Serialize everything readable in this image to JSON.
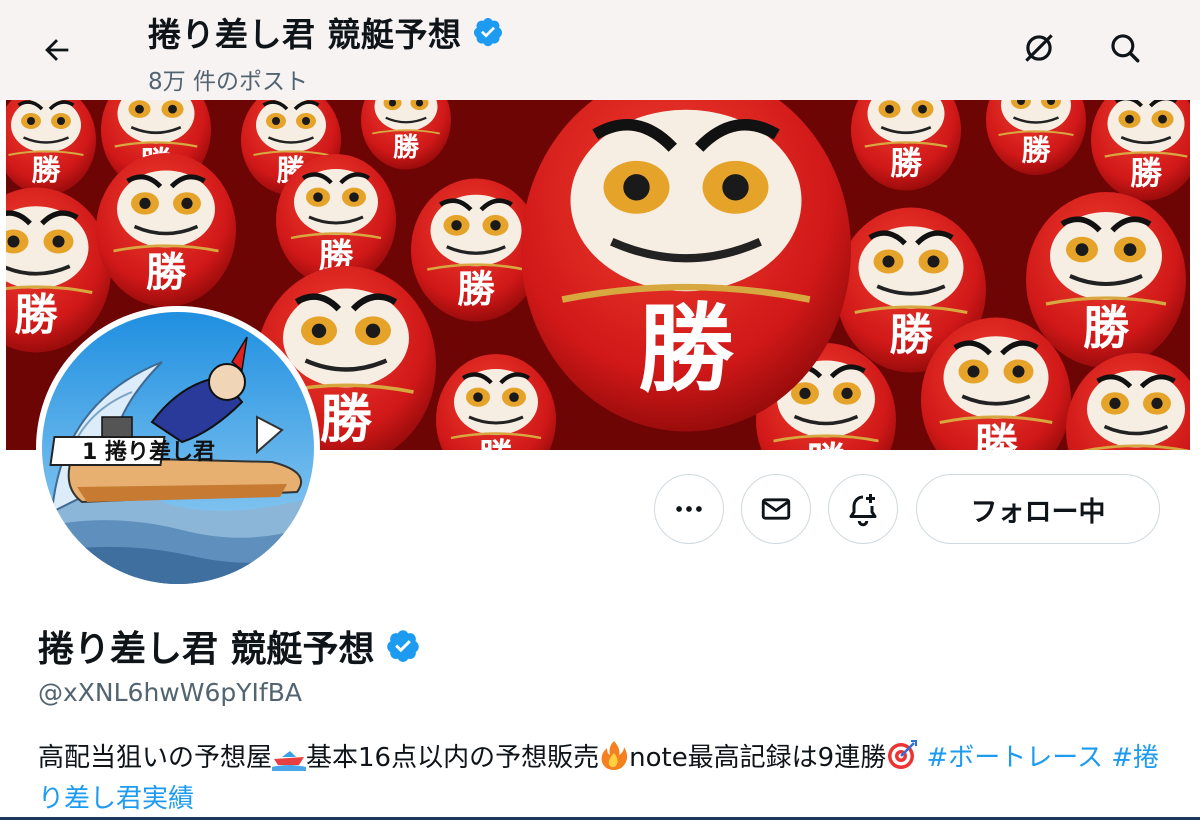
{
  "header": {
    "title": "捲り差し君 競艇予想",
    "post_count": "8万 件のポスト"
  },
  "profile": {
    "display_name": "捲り差し君 競艇予想",
    "handle": "@xXNL6hwW6pYIfBA",
    "verified": true,
    "bio_parts": {
      "p1": "高配当狙いの予想屋",
      "p2": "基本16点以内の予想販売",
      "p3": "note最高記録は9連勝",
      "tag1": "#ボートレース",
      "tag2": "#捲り差し君実績"
    },
    "banner_kanji": "勝",
    "avatar_boat_label": "1 捲り差し君"
  },
  "actions": {
    "more_icon": "more-icon",
    "message_icon": "mail-icon",
    "notify_icon": "bell-plus-icon",
    "follow_label": "フォロー中"
  },
  "colors": {
    "accent": "#1d9bf0",
    "daruma_red": "#d81e1e",
    "text_secondary": "#536471"
  }
}
